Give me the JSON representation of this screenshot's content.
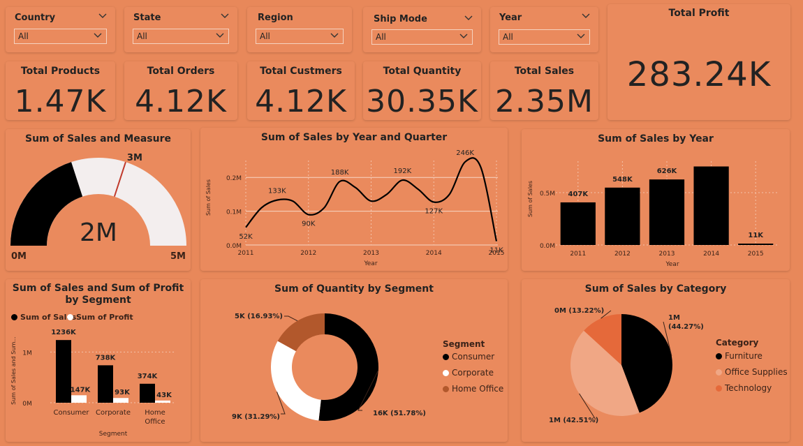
{
  "slicers": [
    {
      "label": "Country",
      "value": "All"
    },
    {
      "label": "State",
      "value": "All"
    },
    {
      "label": "Region",
      "value": "All"
    },
    {
      "label": "Ship Mode",
      "value": "All"
    },
    {
      "label": "Year",
      "value": "All"
    }
  ],
  "kpis": {
    "total_profit": {
      "label": "Total Profit",
      "value": "283.24K"
    },
    "total_products": {
      "label": "Total Products",
      "value": "1.47K"
    },
    "total_orders": {
      "label": "Total Orders",
      "value": "4.12K"
    },
    "total_customers": {
      "label": "Total Custmers",
      "value": "4.12K"
    },
    "total_quantity": {
      "label": "Total Quantity",
      "value": "30.35K"
    },
    "total_sales": {
      "label": "Total Sales",
      "value": "2.35M"
    }
  },
  "colors": {
    "background": "#e8885a",
    "card": "#ea8a5d",
    "black": "#000000",
    "white": "#ffffff",
    "light": "#f3eeee",
    "brown": "#b2582c",
    "salmon": "#f0a785",
    "deep_orange": "#e5693a",
    "target_line": "#c0392b"
  },
  "chart_data": [
    {
      "type": "gauge",
      "title": "Sum of Sales and Measure",
      "value": 2,
      "value_label": "2M",
      "min": 0,
      "min_label": "0M",
      "max": 5,
      "max_label": "5M",
      "target": 3,
      "target_label": "3M"
    },
    {
      "type": "line",
      "title": "Sum of Sales by Year and Quarter",
      "xlabel": "Year",
      "ylabel": "Sum of Sales",
      "x_ticks": [
        "2011",
        "2012",
        "2013",
        "2014",
        "2015"
      ],
      "y_ticks": [
        "0.0M",
        "0.1M",
        "0.2M"
      ],
      "ylim": [
        0,
        0.25
      ],
      "points": [
        {
          "x": 2011.0,
          "y": 0.052,
          "label": "52K"
        },
        {
          "x": 2011.25,
          "y": 0.11,
          "label": ""
        },
        {
          "x": 2011.5,
          "y": 0.133,
          "label": "133K"
        },
        {
          "x": 2011.75,
          "y": 0.13,
          "label": ""
        },
        {
          "x": 2012.0,
          "y": 0.09,
          "label": "90K"
        },
        {
          "x": 2012.25,
          "y": 0.11,
          "label": ""
        },
        {
          "x": 2012.5,
          "y": 0.188,
          "label": "188K"
        },
        {
          "x": 2012.75,
          "y": 0.17,
          "label": ""
        },
        {
          "x": 2013.0,
          "y": 0.13,
          "label": ""
        },
        {
          "x": 2013.25,
          "y": 0.15,
          "label": ""
        },
        {
          "x": 2013.5,
          "y": 0.192,
          "label": "192K"
        },
        {
          "x": 2013.75,
          "y": 0.165,
          "label": ""
        },
        {
          "x": 2014.0,
          "y": 0.127,
          "label": "127K"
        },
        {
          "x": 2014.25,
          "y": 0.15,
          "label": ""
        },
        {
          "x": 2014.5,
          "y": 0.246,
          "label": "246K"
        },
        {
          "x": 2014.75,
          "y": 0.23,
          "label": ""
        },
        {
          "x": 2015.0,
          "y": 0.011,
          "label": "11K"
        }
      ]
    },
    {
      "type": "bar",
      "title": "Sum of Sales by Year",
      "xlabel": "Year",
      "ylabel": "Sum of Sales",
      "categories": [
        "2011",
        "2012",
        "2013",
        "2014",
        "2015"
      ],
      "values": [
        0.407,
        0.548,
        0.626,
        0.75,
        0.011
      ],
      "labels": [
        "407K",
        "548K",
        "626K",
        "",
        "11K"
      ],
      "y_ticks": [
        "0.0M",
        "0.5M"
      ],
      "ylim": [
        0,
        0.8
      ]
    },
    {
      "type": "bar",
      "title": "Sum of Sales and Sum of Profit by Segment",
      "xlabel": "Segment",
      "ylabel": "Sum of Sales and Sum...",
      "categories": [
        "Consumer",
        "Corporate",
        "Home Office"
      ],
      "series": [
        {
          "name": "Sum of Sales",
          "values": [
            1.236,
            0.738,
            0.374
          ],
          "labels": [
            "1236K",
            "738K",
            "374K"
          ]
        },
        {
          "name": "Sum of Profit",
          "values": [
            0.147,
            0.093,
            0.043
          ],
          "labels": [
            "147K",
            "93K",
            "43K"
          ]
        }
      ],
      "y_ticks": [
        "0M",
        "1M"
      ],
      "ylim": [
        0,
        1.5
      ]
    },
    {
      "type": "pie",
      "title": "Sum of Quantity by Segment",
      "donut": true,
      "legend_title": "Segment",
      "slices": [
        {
          "name": "Consumer",
          "value": 51.78,
          "label": "16K (51.78%)"
        },
        {
          "name": "Corporate",
          "value": 31.29,
          "label": "9K (31.29%)"
        },
        {
          "name": "Home Office",
          "value": 16.93,
          "label": "5K (16.93%)"
        }
      ]
    },
    {
      "type": "pie",
      "title": "Sum of Sales by Category",
      "donut": false,
      "legend_title": "Category",
      "slices": [
        {
          "name": "Furniture",
          "value": 44.27,
          "label": "1M (44.27%)"
        },
        {
          "name": "Office Supplies",
          "value": 42.51,
          "label": "1M (42.51%)"
        },
        {
          "name": "Technology",
          "value": 13.22,
          "label": "0M (13.22%)"
        }
      ]
    }
  ]
}
